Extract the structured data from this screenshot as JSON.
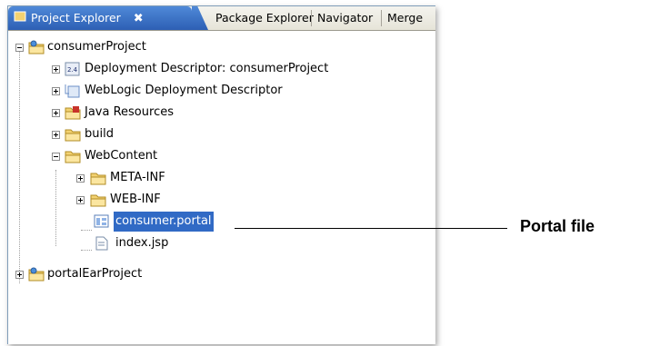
{
  "tabs": [
    {
      "label": "Project Explorer",
      "active": true,
      "close": "✖"
    },
    {
      "label": "Package Explorer"
    },
    {
      "label": "Navigator"
    },
    {
      "label": "Merge"
    }
  ],
  "tree": {
    "project": "consumerProject",
    "children": [
      {
        "label": "Deployment Descriptor: consumerProject"
      },
      {
        "label": "WebLogic Deployment Descriptor"
      },
      {
        "label": "Java Resources"
      },
      {
        "label": "build"
      },
      {
        "label": "WebContent",
        "children": [
          {
            "label": "META-INF"
          },
          {
            "label": "WEB-INF"
          },
          {
            "label": "consumer.portal"
          },
          {
            "label": "index.jsp"
          }
        ]
      }
    ],
    "project2": "portalEarProject"
  },
  "callout": {
    "text": "Portal file"
  },
  "colors": {
    "selection": "#316ac5",
    "tab_active": "#2d5fb4",
    "folder": "#f3d271"
  }
}
